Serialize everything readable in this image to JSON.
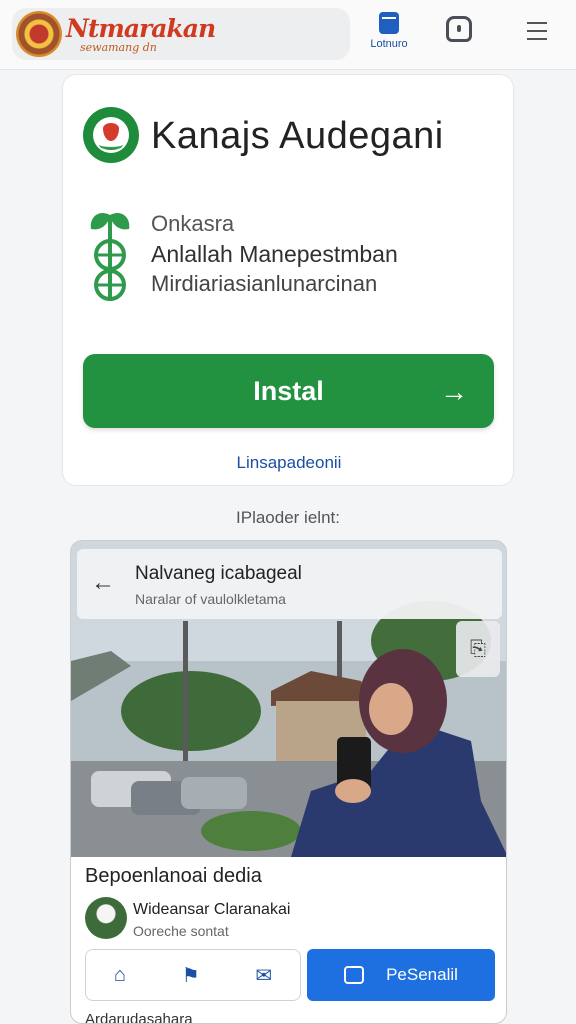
{
  "topbar": {
    "logo_text": "Ntmarakan",
    "logo_sub": "sewamang dn",
    "button_label": "Lotnuro",
    "icons": [
      "phone-icon",
      "bell-icon",
      "menu-icon"
    ]
  },
  "app": {
    "title": "Kanajs Audegani",
    "description": [
      "Onkasra",
      "Anlallah Manepestmban",
      "Mirdiariasianlunarcinan"
    ],
    "install_label": "Instal",
    "install_arrow": "→",
    "link_label": "Linsapadeonii"
  },
  "section_label": "IPlaoder ielnt:",
  "preview": {
    "header_title": "Nalvaneg icabageal",
    "header_sub": "Naralar of vaulolkletama",
    "post_title": "Bepoenlanoai dedia",
    "author": "Wideansar Claranakai",
    "author_sub": "Ooreche sontat",
    "action_label": "PeSenalil",
    "next_row_text": "Ardarudasahara"
  },
  "colors": {
    "accent_green": "#229140",
    "accent_blue": "#1e6fe0",
    "link_blue": "#1a4fa3",
    "logo_red": "#d03a1f"
  }
}
